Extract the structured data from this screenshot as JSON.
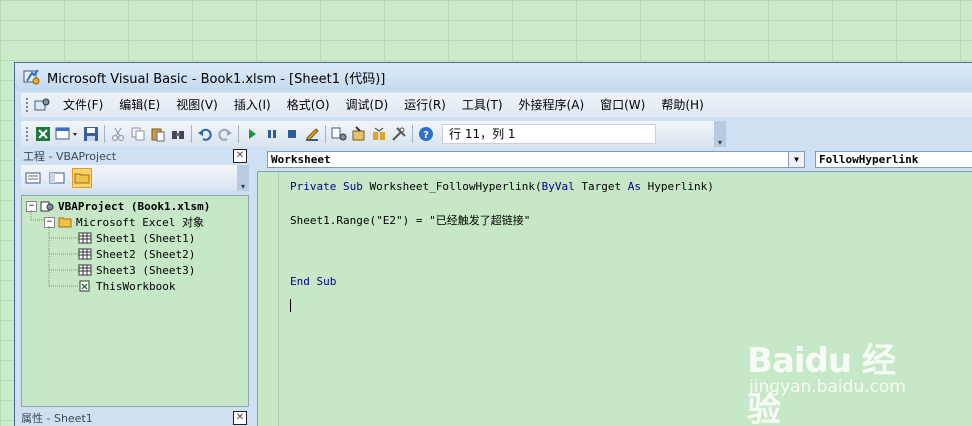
{
  "window": {
    "title": "Microsoft Visual Basic - Book1.xlsm - [Sheet1 (代码)]"
  },
  "menu": [
    {
      "label": "文件(F)"
    },
    {
      "label": "编辑(E)"
    },
    {
      "label": "视图(V)"
    },
    {
      "label": "插入(I)"
    },
    {
      "label": "格式(O)"
    },
    {
      "label": "调试(D)"
    },
    {
      "label": "运行(R)"
    },
    {
      "label": "工具(T)"
    },
    {
      "label": "外接程序(A)"
    },
    {
      "label": "窗口(W)"
    },
    {
      "label": "帮助(H)"
    }
  ],
  "toolbar": {
    "position_text": "行 11，列 1",
    "icons": [
      "excel-icon",
      "insert-userform-icon",
      "save-icon",
      "cut-icon",
      "copy-icon",
      "paste-icon",
      "find-icon",
      "undo-icon",
      "redo-icon",
      "run-icon",
      "break-icon",
      "reset-icon",
      "design-mode-icon",
      "project-explorer-icon",
      "properties-icon",
      "object-browser-icon",
      "toolbox-icon",
      "help-icon"
    ]
  },
  "project_pane": {
    "title": "工程 - VBAProject",
    "close": "✕",
    "tree": {
      "root": "VBAProject (Book1.xlsm)",
      "folder": "Microsoft Excel 对象",
      "items": [
        "Sheet1 (Sheet1)",
        "Sheet2 (Sheet2)",
        "Sheet3 (Sheet3)",
        "ThisWorkbook"
      ]
    }
  },
  "properties_pane": {
    "title": "属性 - Sheet1",
    "close": "✕"
  },
  "code": {
    "object_combo": "Worksheet",
    "procedure_combo": "FollowHyperlink",
    "lines": {
      "l1_kw1": "Private Sub",
      "l1_mid": " Worksheet_FollowHyperlink(",
      "l1_kw2": "ByVal",
      "l1_mid2": " Target ",
      "l1_kw3": "As",
      "l1_end": " Hyperlink)",
      "l2": "Sheet1.Range(\"E2\") = \"已经触发了超链接\"",
      "l3": "End Sub"
    }
  },
  "watermark": {
    "brand": "Baidu 经验",
    "site": "jingyan.baidu.com"
  },
  "colors": {
    "background": "#cbeccb",
    "code_keyword": "#00008b",
    "chrome": "#cfe0f2"
  }
}
